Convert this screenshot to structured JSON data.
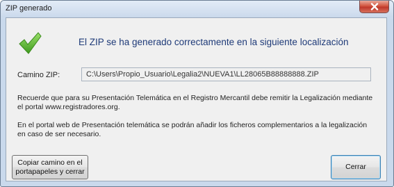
{
  "window": {
    "title": "ZIP generado"
  },
  "titlebar": {
    "close_icon": "close-icon"
  },
  "main": {
    "status_icon": "checkmark-icon",
    "status_icon_color": "#5cb82e",
    "headline": "El ZIP se ha generado correctamente en la siguiente localización",
    "path_label": "Camino ZIP:",
    "path_value": "C:\\Users\\Propio_Usuario\\Legalia2\\NUEVA1\\LL28065B88888888.ZIP",
    "info_1": "Recuerde que para su Presentación Telemática en el Registro Mercantil debe remitir la Legalización mediante el portal www.registradores.org.",
    "info_2": "En el portal web de Presentación telemática se podrán añadir los ficheros complementarios a la legalización en caso de ser necesario."
  },
  "buttons": {
    "copy_label": "Copiar camino en el\nportapapeles y cerrar",
    "close_label": "Cerrar"
  }
}
